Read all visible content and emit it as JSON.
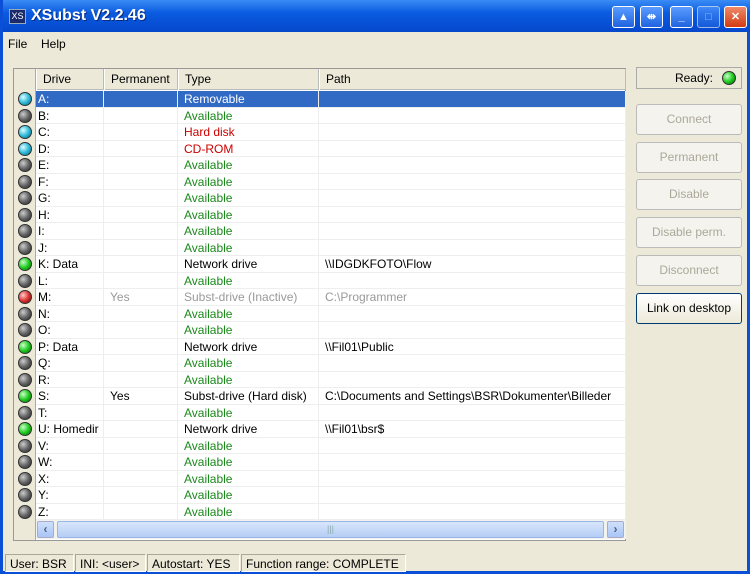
{
  "window": {
    "title": "XSubst V2.2.46",
    "icon_text": "XS"
  },
  "menu": [
    "File",
    "Help"
  ],
  "columns": [
    "Drive",
    "Permanent",
    "Type",
    "Path"
  ],
  "colors": {
    "available": "#1a8a1a",
    "hard_disk": "#cc0000",
    "inactive": "#999999",
    "selected": "#316ac5"
  },
  "rows": [
    {
      "drive": "A:",
      "permanent": "",
      "type": "Removable",
      "path": "",
      "led": "cyan",
      "style": "normal",
      "selected": true
    },
    {
      "drive": "B:",
      "permanent": "",
      "type": "Available",
      "path": "",
      "led": "gray",
      "style": "available"
    },
    {
      "drive": "C:",
      "permanent": "",
      "type": "Hard disk",
      "path": "",
      "led": "cyan",
      "style": "harddisk"
    },
    {
      "drive": "D:",
      "permanent": "",
      "type": "CD-ROM",
      "path": "",
      "led": "cyan",
      "style": "harddisk"
    },
    {
      "drive": "E:",
      "permanent": "",
      "type": "Available",
      "path": "",
      "led": "gray",
      "style": "available"
    },
    {
      "drive": "F:",
      "permanent": "",
      "type": "Available",
      "path": "",
      "led": "gray",
      "style": "available"
    },
    {
      "drive": "G:",
      "permanent": "",
      "type": "Available",
      "path": "",
      "led": "gray",
      "style": "available"
    },
    {
      "drive": "H:",
      "permanent": "",
      "type": "Available",
      "path": "",
      "led": "gray",
      "style": "available"
    },
    {
      "drive": "I:",
      "permanent": "",
      "type": "Available",
      "path": "",
      "led": "gray",
      "style": "available"
    },
    {
      "drive": "J:",
      "permanent": "",
      "type": "Available",
      "path": "",
      "led": "gray",
      "style": "available"
    },
    {
      "drive": "K: Data",
      "permanent": "",
      "type": "Network drive",
      "path": "\\\\IDGDKFOTO\\Flow",
      "led": "green",
      "style": "normal"
    },
    {
      "drive": "L:",
      "permanent": "",
      "type": "Available",
      "path": "",
      "led": "gray",
      "style": "available"
    },
    {
      "drive": "M:",
      "permanent": "Yes",
      "type": "Subst-drive (Inactive)",
      "path": "C:\\Programmer",
      "led": "red",
      "style": "inactive"
    },
    {
      "drive": "N:",
      "permanent": "",
      "type": "Available",
      "path": "",
      "led": "gray",
      "style": "available"
    },
    {
      "drive": "O:",
      "permanent": "",
      "type": "Available",
      "path": "",
      "led": "gray",
      "style": "available"
    },
    {
      "drive": "P: Data",
      "permanent": "",
      "type": "Network drive",
      "path": "\\\\Fil01\\Public",
      "led": "green",
      "style": "normal"
    },
    {
      "drive": "Q:",
      "permanent": "",
      "type": "Available",
      "path": "",
      "led": "gray",
      "style": "available"
    },
    {
      "drive": "R:",
      "permanent": "",
      "type": "Available",
      "path": "",
      "led": "gray",
      "style": "available"
    },
    {
      "drive": "S:",
      "permanent": "Yes",
      "type": "Subst-drive (Hard disk)",
      "path": "C:\\Documents and Settings\\BSR\\Dokumenter\\Billeder",
      "led": "green",
      "style": "normal"
    },
    {
      "drive": "T:",
      "permanent": "",
      "type": "Available",
      "path": "",
      "led": "gray",
      "style": "available"
    },
    {
      "drive": "U: Homedir",
      "permanent": "",
      "type": "Network drive",
      "path": "\\\\Fil01\\bsr$",
      "led": "green",
      "style": "normal"
    },
    {
      "drive": "V:",
      "permanent": "",
      "type": "Available",
      "path": "",
      "led": "gray",
      "style": "available"
    },
    {
      "drive": "W:",
      "permanent": "",
      "type": "Available",
      "path": "",
      "led": "gray",
      "style": "available"
    },
    {
      "drive": "X:",
      "permanent": "",
      "type": "Available",
      "path": "",
      "led": "gray",
      "style": "available"
    },
    {
      "drive": "Y:",
      "permanent": "",
      "type": "Available",
      "path": "",
      "led": "gray",
      "style": "available"
    },
    {
      "drive": "Z:",
      "permanent": "",
      "type": "Available",
      "path": "",
      "led": "gray",
      "style": "available"
    }
  ],
  "ready_label": "Ready:",
  "buttons": [
    {
      "label": "Connect",
      "enabled": false
    },
    {
      "label": "Permanent",
      "enabled": false
    },
    {
      "label": "Disable",
      "enabled": false
    },
    {
      "label": "Disable perm.",
      "enabled": false
    },
    {
      "label": "Disconnect",
      "enabled": false
    },
    {
      "label": "Link on desktop",
      "enabled": true
    }
  ],
  "status": [
    "User: BSR",
    "INI: <user>",
    "Autostart: YES",
    "Function range: COMPLETE"
  ]
}
